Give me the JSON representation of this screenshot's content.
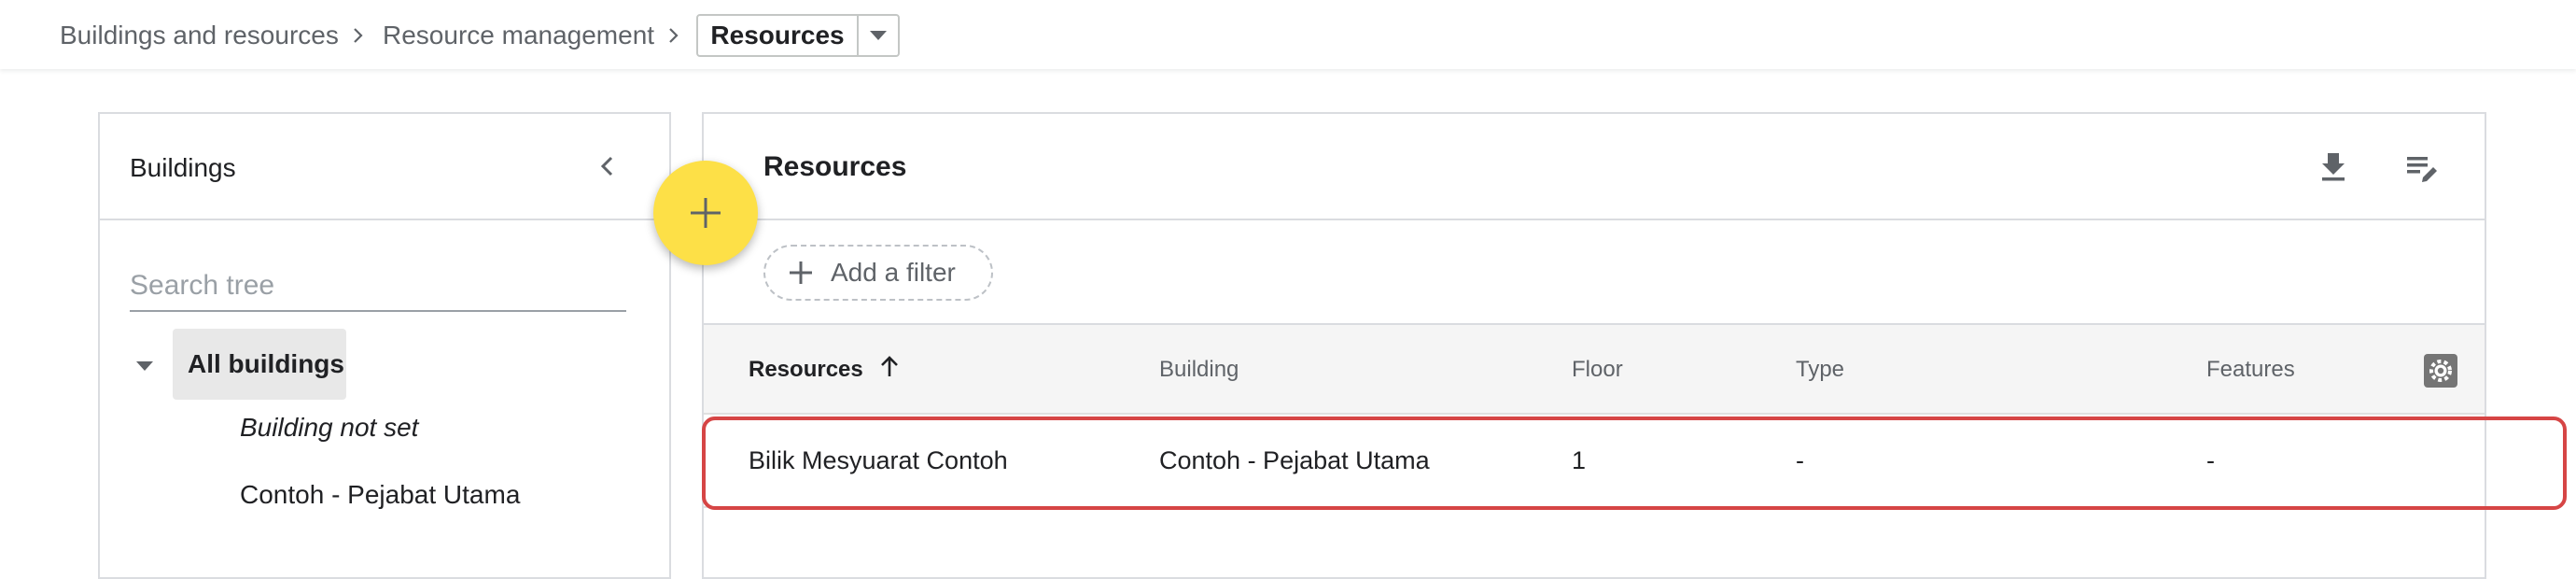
{
  "breadcrumb": {
    "items": [
      "Buildings and resources",
      "Resource management"
    ],
    "current": "Resources"
  },
  "buildings_panel": {
    "title": "Buildings",
    "search_placeholder": "Search tree",
    "tree": {
      "root": "All buildings",
      "children": [
        "Building not set",
        "Contoh - Pejabat Utama"
      ]
    }
  },
  "fab": {
    "icon": "plus-icon"
  },
  "resources_panel": {
    "title": "Resources",
    "actions": [
      "download-icon",
      "edit-columns-icon"
    ],
    "filter_label": "Add a filter",
    "columns": [
      "Resources",
      "Building",
      "Floor",
      "Type",
      "Features"
    ],
    "sort_column": "Resources",
    "sort_direction": "ascending",
    "rows": [
      {
        "resource": "Bilik Mesyuarat Contoh",
        "building": "Contoh - Pejabat Utama",
        "floor": "1",
        "type": "-",
        "features": "-"
      }
    ]
  },
  "colors": {
    "fab": "#fde047",
    "highlight": "#d64545",
    "table_header": "#f5f5f5"
  }
}
